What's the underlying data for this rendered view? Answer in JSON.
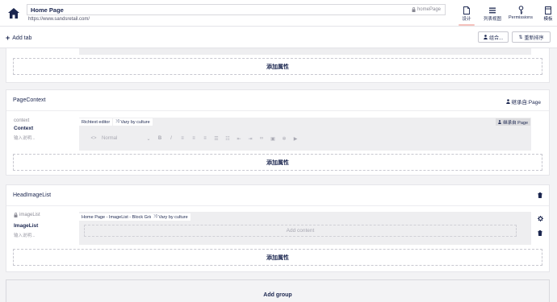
{
  "header": {
    "name_value": "Home Page",
    "alias_text": "homePage",
    "url": "https://www.sandsretail.com/",
    "nav": [
      {
        "label": "设计",
        "icon": "document-icon"
      },
      {
        "label": "列表视图",
        "icon": "list-view-icon"
      },
      {
        "label": "Permissions",
        "icon": "key-icon"
      },
      {
        "label": "模板",
        "icon": "template-icon"
      }
    ]
  },
  "tabbar": {
    "add_tab": "Add tab",
    "compose_button": "组合...",
    "reorder_button": "重新排序"
  },
  "top_section": {
    "add_property": "添加属性"
  },
  "page_context": {
    "title": "PageContext",
    "inherited": "继承自:Page",
    "property": {
      "alias": "context",
      "name": "Context",
      "description": "输入说明..."
    },
    "editor_tag": "Richtext editor",
    "vary_tag": "Vary by culture",
    "inherit_tag": "继承自 Page",
    "format_select": "Normal",
    "add_property": "添加属性"
  },
  "head_image_list": {
    "title": "HeadImageList",
    "property": {
      "alias": "imageList",
      "name": "ImageList",
      "description": "输入说明..."
    },
    "editor_tag": "Home Page - ImageList - Block Grid",
    "vary_tag": "Vary by culture",
    "add_content": "Add content",
    "add_property": "添加属性"
  },
  "add_group": "Add group",
  "colors": {
    "primary_text": "#1b264f",
    "active_tab_underline": "#f5c1bc",
    "background": "#f3f3f5",
    "editor_bg": "#eeeef0"
  }
}
